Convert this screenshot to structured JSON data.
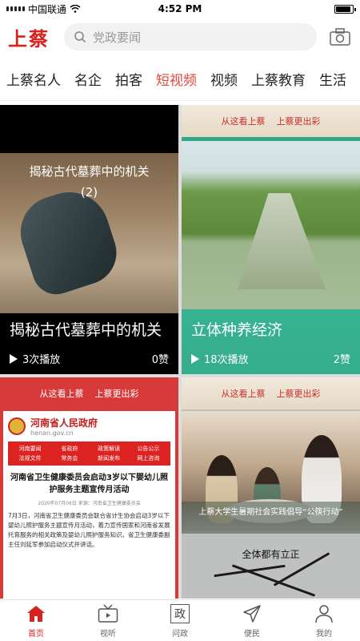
{
  "status_bar": {
    "carrier": "中国联通",
    "time": "4:52 PM",
    "battery_level": 0.9
  },
  "header": {
    "logo": "上蔡",
    "search_placeholder": "党政要闻"
  },
  "tabs": [
    {
      "label": "上蔡名人"
    },
    {
      "label": "名企"
    },
    {
      "label": "拍客"
    },
    {
      "label": "短视频",
      "active": true
    },
    {
      "label": "视频"
    },
    {
      "label": "上蔡教育"
    },
    {
      "label": "生活"
    }
  ],
  "videos": [
    {
      "overlay_line1": "揭秘古代墓葬中的机关",
      "overlay_line2": "(2)",
      "title": "揭秘古代墓葬中的机关",
      "plays": "3次播放",
      "likes": "0赞"
    },
    {
      "banner_left": "从这看上蔡",
      "banner_right": "上蔡更出彩",
      "title": "立体种养经济",
      "plays": "18次播放",
      "likes": "2赞"
    },
    {
      "banner_left": "从这看上蔡",
      "banner_right": "上蔡更出彩",
      "gov_name": "河南省人民政府",
      "gov_url": "henan.gov.cn",
      "gov_nav": [
        "河南要闻",
        "省政府",
        "政策解读",
        "公告公示",
        "法规文件",
        "常务会",
        "新闻发布",
        "网上咨询"
      ],
      "doc_title": "河南省卫生健康委员会启动3岁以下婴幼儿照护服务主题宣传月活动",
      "doc_meta": "2020年07月06日 来源：河南省卫生健康委员会",
      "doc_body": "7月3日，河南省卫生健康委员会联合省计生协会启动3岁以下婴幼儿照护服务主题宣传月活动，着力宣传国家和河南省发展托育服务的相关政策及婴幼儿照护服务知识。省卫生健康委副主任刘延军参加启动仪式并讲话。"
    },
    {
      "banner_left": "从这看上蔡",
      "banner_right": "上蔡更出彩",
      "caption": "上蔡大学生暑期社会实践倡导“公筷行动”",
      "note": "全体都有立正"
    }
  ],
  "bottom_nav": [
    {
      "label": "首页",
      "icon": "home-icon",
      "active": true
    },
    {
      "label": "视听",
      "icon": "tv-icon"
    },
    {
      "label": "问政",
      "icon": "zheng-icon",
      "glyph": "政"
    },
    {
      "label": "便民",
      "icon": "send-icon"
    },
    {
      "label": "我的",
      "icon": "user-icon"
    }
  ],
  "colors": {
    "brand_red": "#d8221e",
    "active_tab": "#e2463c",
    "teal": "#2aa283"
  }
}
